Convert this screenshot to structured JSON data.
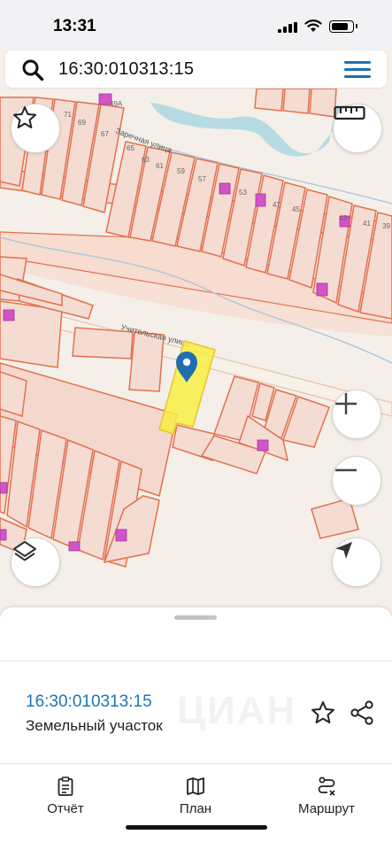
{
  "status_bar": {
    "time": "13:31"
  },
  "search": {
    "query": "16:30:010313:15"
  },
  "map": {
    "street_labels": [
      "Учительская улица",
      "Заречная улица"
    ],
    "house_numbers": [
      "49А",
      "71",
      "69",
      "67",
      "65",
      "63",
      "61",
      "59",
      "57",
      "53",
      "47",
      "45",
      "43",
      "41",
      "39"
    ],
    "colors": {
      "background": "#f4efe8",
      "parcel_stroke": "#e2714f",
      "parcel_fill": "#f5dcd2",
      "selected_parcel": "#f8ee45",
      "water": "#b6dbe3",
      "building": "#d353c9",
      "pin": "#1f6fb0"
    }
  },
  "map_buttons": {
    "favorite": "star-icon",
    "ruler": "ruler-icon",
    "zoom_in": "plus-icon",
    "zoom_out": "minus-icon",
    "layers": "layers-icon",
    "locate": "navigation-arrow-icon"
  },
  "sheet": {
    "parcel_number": "16:30:010313:15",
    "parcel_type": "Земельный участок",
    "watermark": "ЦИАН"
  },
  "tabs": [
    {
      "label": "Отчёт",
      "icon": "clipboard-icon"
    },
    {
      "label": "План",
      "icon": "map-icon"
    },
    {
      "label": "Маршрут",
      "icon": "route-icon"
    }
  ]
}
